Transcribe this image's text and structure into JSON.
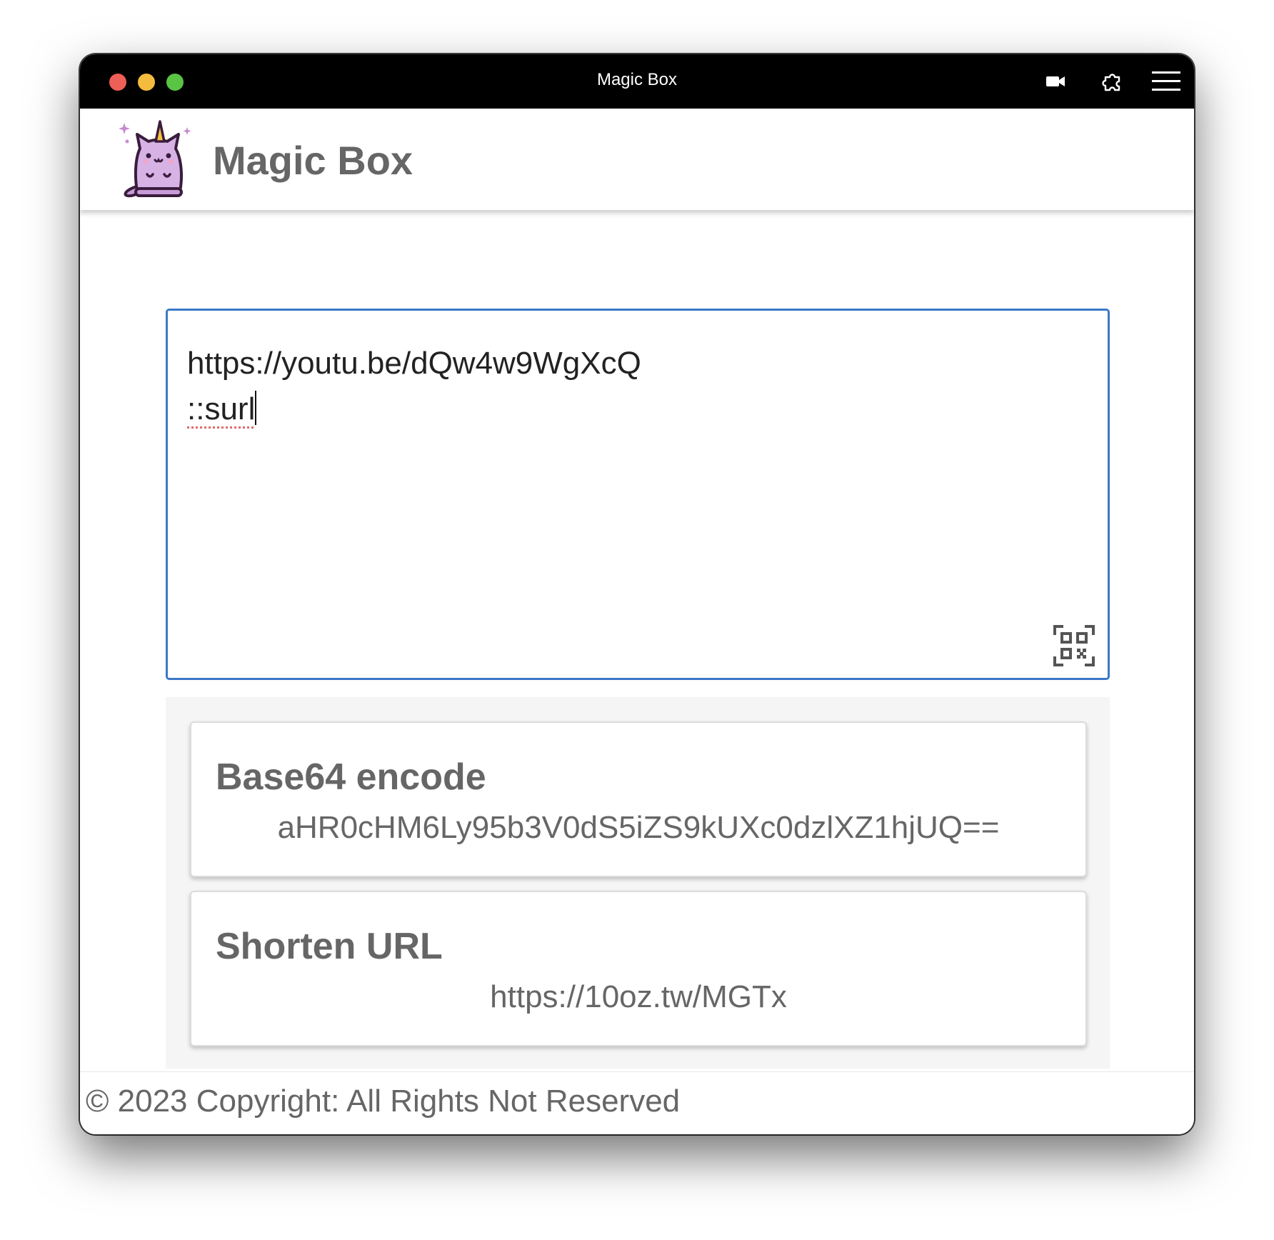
{
  "window": {
    "title": "Magic Box"
  },
  "titlebar_icons": [
    "video-camera-icon",
    "extension-puzzle-icon",
    "hamburger-menu-icon"
  ],
  "header": {
    "app_name": "Magic Box",
    "logo_icon": "unicorn-cat-logo"
  },
  "input": {
    "line1": "https://youtu.be/dQw4w9WgXcQ",
    "line2": "::surl",
    "qr_icon": "qr-code-icon"
  },
  "results": [
    {
      "title": "Base64 encode",
      "value": "aHR0cHM6Ly95b3V0dS5iZS9kUXc0dzlXZ1hjUQ=="
    },
    {
      "title": "Shorten URL",
      "value": "https://10oz.tw/MGTx"
    }
  ],
  "footer": {
    "text": "© 2023 Copyright: All Rights Not Reserved"
  },
  "colors": {
    "titlebar": "#000000",
    "accent_border": "#3b78c8",
    "text_gray": "#666666",
    "results_bg": "#f5f5f5",
    "traffic_close": "#ee5f57",
    "traffic_min": "#f4bb3e",
    "traffic_max": "#5ac443"
  }
}
